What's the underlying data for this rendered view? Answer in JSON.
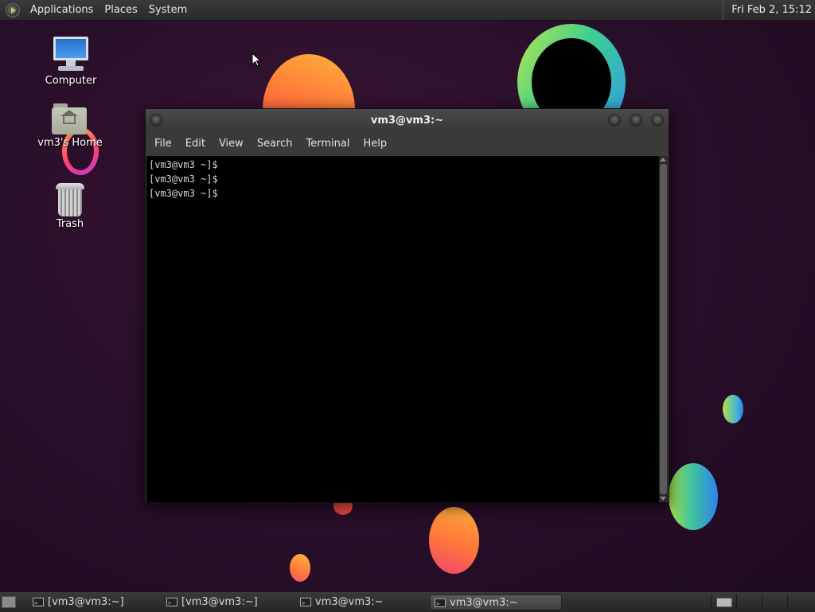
{
  "top_panel": {
    "menus": [
      "Applications",
      "Places",
      "System"
    ],
    "clock": "Fri Feb  2, 15:12"
  },
  "desktop": {
    "icons": [
      {
        "label": "Computer",
        "icon": "computer-icon"
      },
      {
        "label": "vm3's Home",
        "icon": "home-folder-icon"
      },
      {
        "label": "Trash",
        "icon": "trash-icon"
      }
    ]
  },
  "terminal": {
    "title": "vm3@vm3:~",
    "menus": [
      "File",
      "Edit",
      "View",
      "Search",
      "Terminal",
      "Help"
    ],
    "lines": [
      "[vm3@vm3 ~]$",
      "[vm3@vm3 ~]$",
      "[vm3@vm3 ~]$"
    ]
  },
  "taskbar": {
    "tasks": [
      {
        "label": "[vm3@vm3:~]",
        "active": false
      },
      {
        "label": "[vm3@vm3:~]",
        "active": false
      },
      {
        "label": "vm3@vm3:~",
        "active": false
      },
      {
        "label": "vm3@vm3:~",
        "active": true
      }
    ]
  },
  "colors": {
    "desktop_bg": "#2a0f2a",
    "panel_bg": "#2e2e2e",
    "terminal_bg": "#000000",
    "terminal_fg": "#d8d8d8"
  }
}
